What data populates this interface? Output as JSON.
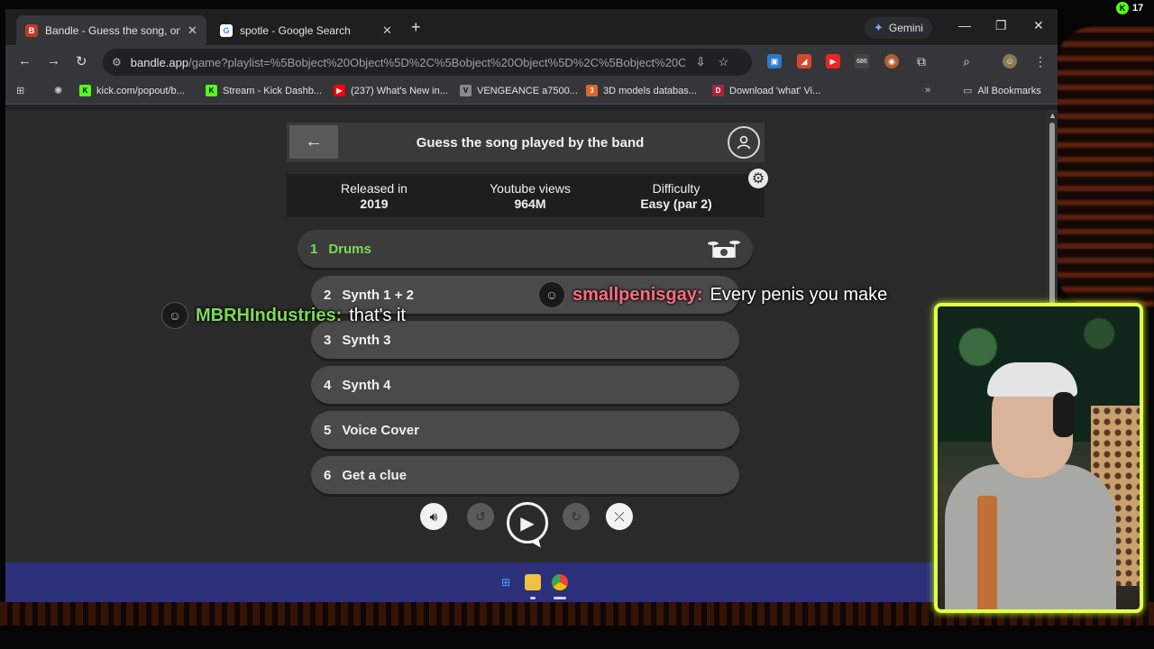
{
  "browser": {
    "tabs": [
      {
        "title": "Bandle - Guess the song, one in",
        "favicon_color": "#c0392b",
        "favicon_letter": "B",
        "active": true
      },
      {
        "title": "spotle - Google Search",
        "favicon_color": "#ffffff",
        "favicon_letter": "G",
        "active": false
      }
    ],
    "gemini_label": "Gemini",
    "url_host": "bandle.app",
    "url_path": "/game?playlist=%5Bobject%20Object%5D%2C%5Bobject%20Object%5D%2C%5Bobject%20Obj...",
    "extension_badge": "686",
    "bookmarks": [
      {
        "label": "kick.com/popout/b...",
        "color": "#53fc18",
        "letter": "K"
      },
      {
        "label": "Stream - Kick Dashb...",
        "color": "#53fc18",
        "letter": "K"
      },
      {
        "label": "(237) What's New in...",
        "color": "#ff0000",
        "letter": "▶"
      },
      {
        "label": "VENGEANCE a7500...",
        "color": "#888888",
        "letter": "V"
      },
      {
        "label": "3D models databas...",
        "color": "#e0632a",
        "letter": "3"
      },
      {
        "label": "Download 'what' Vi...",
        "color": "#b0223a",
        "letter": "D"
      }
    ],
    "all_bookmarks": "All Bookmarks"
  },
  "game": {
    "title": "Guess the song played by the band",
    "stats": {
      "released_label": "Released in",
      "released_value": "2019",
      "views_label": "Youtube views",
      "views_value": "964M",
      "difficulty_label": "Difficulty",
      "difficulty_value": "Easy (par 2)"
    },
    "tracks": [
      {
        "num": "1",
        "label": "Drums"
      },
      {
        "num": "2",
        "label": "Synth 1 + 2"
      },
      {
        "num": "3",
        "label": "Synth 3"
      },
      {
        "num": "4",
        "label": "Synth 4"
      },
      {
        "num": "5",
        "label": "Voice Cover"
      },
      {
        "num": "6",
        "label": "Get a clue"
      }
    ],
    "accent_done": "#7ed957"
  },
  "chat": [
    {
      "user": "smallpenisgay:",
      "msg": "Every penis you make",
      "color": "#ff6b81"
    },
    {
      "user": "MBRHIndustries:",
      "msg": "that's it",
      "color": "#7ed957"
    }
  ],
  "overlay": {
    "viewer_count": "17",
    "webcam_border": "#e2ff4a"
  }
}
